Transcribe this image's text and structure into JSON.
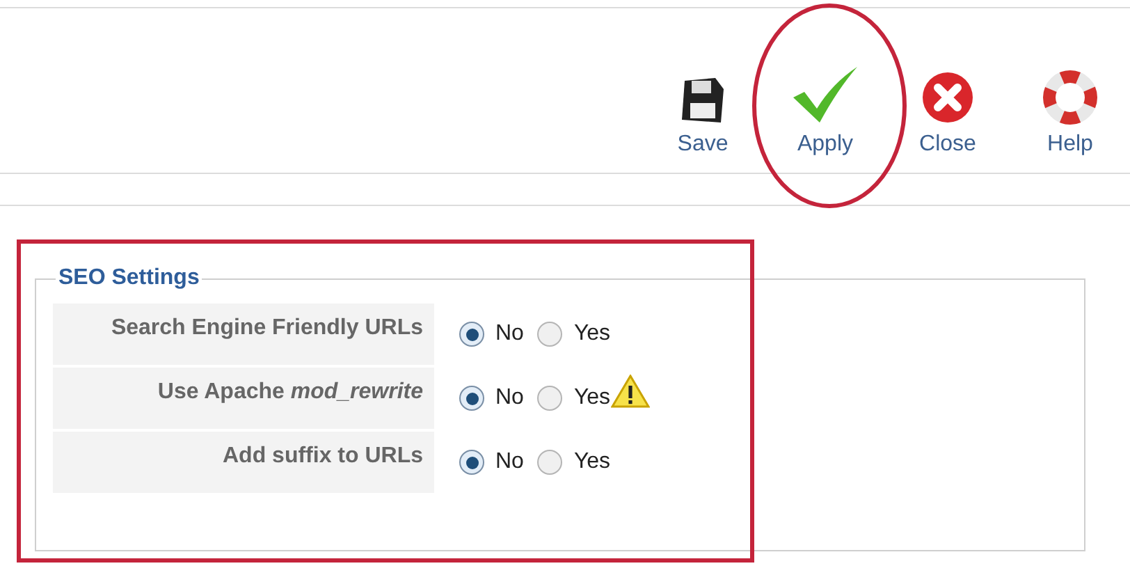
{
  "toolbar": [
    {
      "kind": "save",
      "label": "Save"
    },
    {
      "kind": "apply",
      "label": "Apply"
    },
    {
      "kind": "close",
      "label": "Close"
    },
    {
      "kind": "help",
      "label": "Help"
    }
  ],
  "fieldset": {
    "legend": "SEO Settings",
    "rows": [
      {
        "label": "Search Engine Friendly URLs",
        "warning": false,
        "options": [
          {
            "label": "No",
            "selected": true
          },
          {
            "label": "Yes",
            "selected": false
          }
        ]
      },
      {
        "label": "Use Apache *mod_rewrite*",
        "warning": true,
        "options": [
          {
            "label": "No",
            "selected": true
          },
          {
            "label": "Yes",
            "selected": false
          }
        ]
      },
      {
        "label": "Add suffix to URLs",
        "warning": false,
        "options": [
          {
            "label": "No",
            "selected": true
          },
          {
            "label": "Yes",
            "selected": false
          }
        ]
      }
    ]
  }
}
